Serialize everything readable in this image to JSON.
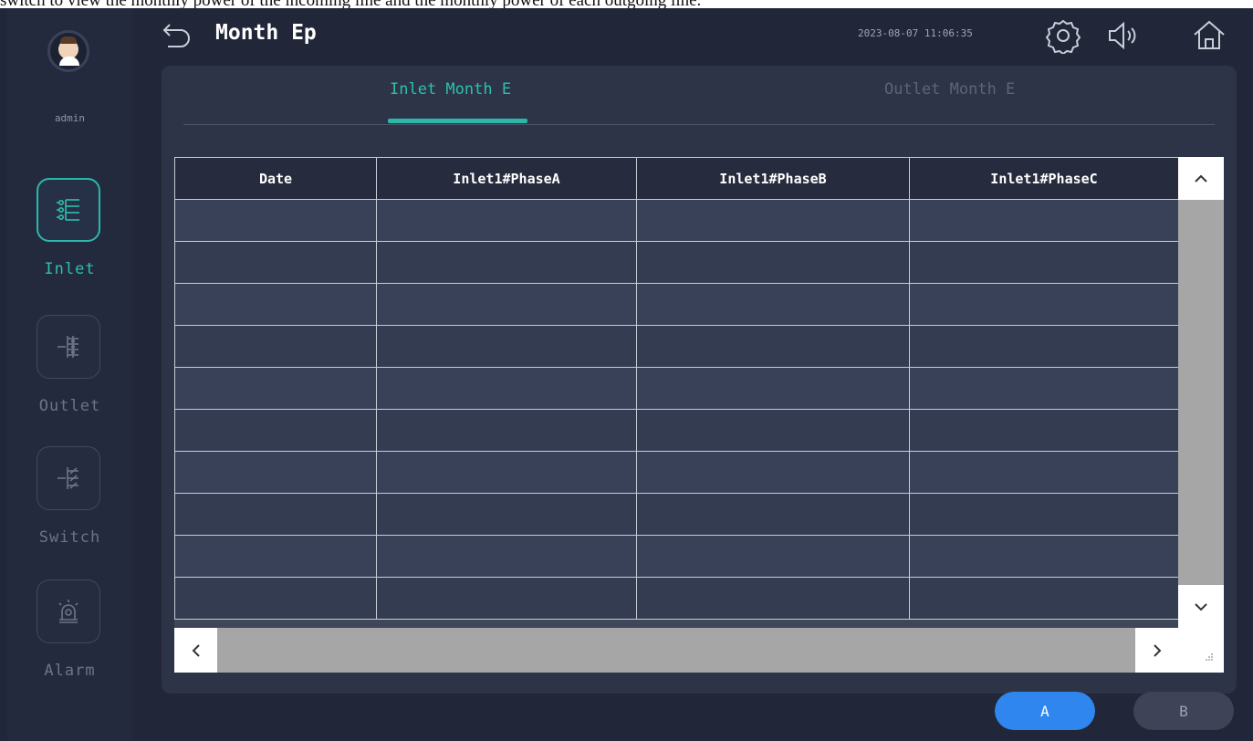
{
  "caption": "switch to view the monthly power of the incoming line and the monthly power of each outgoing line.",
  "user": {
    "name": "admin"
  },
  "nav": [
    {
      "label": "Inlet",
      "icon": "list-settings-icon",
      "active": true
    },
    {
      "label": "Outlet",
      "icon": "distribution-icon",
      "active": false
    },
    {
      "label": "Switch",
      "icon": "switch-icon",
      "active": false
    },
    {
      "label": "Alarm",
      "icon": "alarm-light-icon",
      "active": false
    }
  ],
  "header": {
    "title": "Month Ep",
    "datetime": "2023-08-07 11:06:35",
    "icons": [
      "settings-icon",
      "speaker-icon",
      "home-icon"
    ]
  },
  "tabs": [
    {
      "label": "Inlet Month E",
      "active": true
    },
    {
      "label": "Outlet Month E",
      "active": false
    }
  ],
  "table": {
    "columns": [
      "Date",
      "Inlet1#PhaseA",
      "Inlet1#PhaseB",
      "Inlet1#PhaseC"
    ],
    "rows": [
      [
        "",
        "",
        "",
        ""
      ],
      [
        "",
        "",
        "",
        ""
      ],
      [
        "",
        "",
        "",
        ""
      ],
      [
        "",
        "",
        "",
        ""
      ],
      [
        "",
        "",
        "",
        ""
      ],
      [
        "",
        "",
        "",
        ""
      ],
      [
        "",
        "",
        "",
        ""
      ],
      [
        "",
        "",
        "",
        ""
      ],
      [
        "",
        "",
        "",
        ""
      ],
      [
        "",
        "",
        "",
        ""
      ]
    ]
  },
  "buttons": {
    "a": "A",
    "b": "B"
  },
  "colors": {
    "accent": "#2cb8a8",
    "primary_button": "#2f86ef",
    "background": "#212638"
  }
}
